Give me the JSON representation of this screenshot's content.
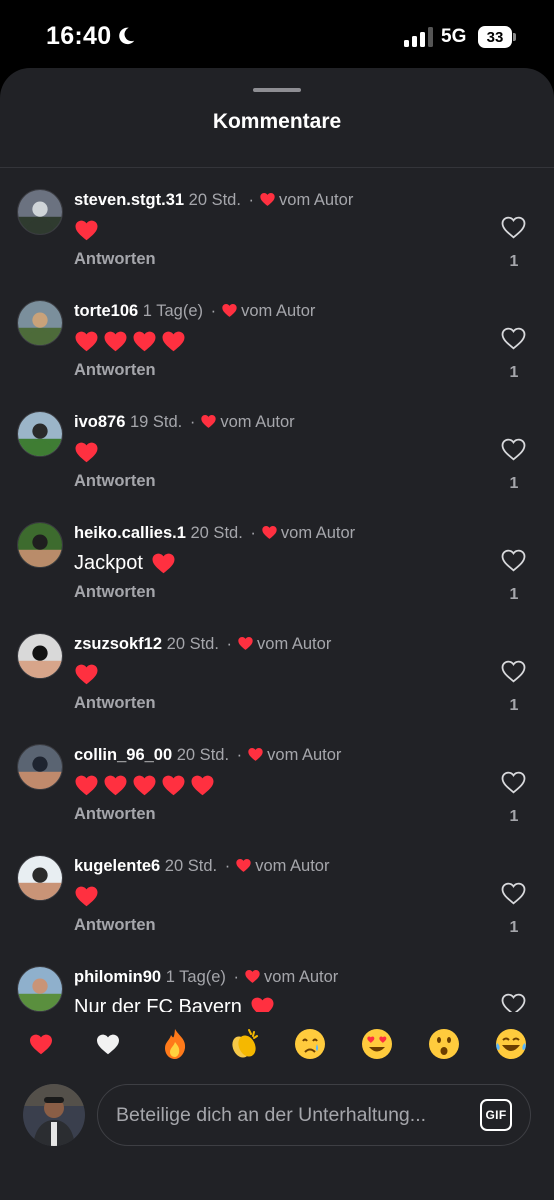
{
  "status_bar": {
    "time": "16:40",
    "network": "5G",
    "battery": "33"
  },
  "sheet": {
    "title": "Kommentare"
  },
  "comments": [
    {
      "username": "steven.stgt.31",
      "time": "20 Std.",
      "author_label": "vom Autor",
      "text": "",
      "hearts": 1,
      "reply_label": "Antworten",
      "likes": "1",
      "avatar_colors": [
        "#6b7280",
        "#2f3b2f",
        "#cfd4d8"
      ]
    },
    {
      "username": "torte106",
      "time": "1 Tag(e)",
      "author_label": "vom Autor",
      "text": "",
      "hearts": 4,
      "reply_label": "Antworten",
      "likes": "1",
      "avatar_colors": [
        "#7b8f9c",
        "#4d6b3a",
        "#c9a27a"
      ]
    },
    {
      "username": "ivo876",
      "time": "19 Std.",
      "author_label": "vom Autor",
      "text": "",
      "hearts": 1,
      "reply_label": "Antworten",
      "likes": "1",
      "avatar_colors": [
        "#9bb5c8",
        "#3f7d34",
        "#2a2a2a"
      ]
    },
    {
      "username": "heiko.callies.1",
      "time": "20 Std.",
      "author_label": "vom Autor",
      "text": "Jackpot",
      "hearts": 1,
      "reply_label": "Antworten",
      "likes": "1",
      "avatar_colors": [
        "#3d6b2e",
        "#b98c6a",
        "#1f1f1f"
      ]
    },
    {
      "username": "zsuzsokf12",
      "time": "20 Std.",
      "author_label": "vom Autor",
      "text": "",
      "hearts": 1,
      "reply_label": "Antworten",
      "likes": "1",
      "avatar_colors": [
        "#d9d9d9",
        "#d7a58a",
        "#111111"
      ]
    },
    {
      "username": "collin_96_00",
      "time": "20 Std.",
      "author_label": "vom Autor",
      "text": "",
      "hearts": 5,
      "reply_label": "Antworten",
      "likes": "1",
      "avatar_colors": [
        "#5a6472",
        "#c08a6c",
        "#1e2430"
      ]
    },
    {
      "username": "kugelente6",
      "time": "20 Std.",
      "author_label": "vom Autor",
      "text": "",
      "hearts": 1,
      "reply_label": "Antworten",
      "likes": "1",
      "avatar_colors": [
        "#e8eef2",
        "#c99477",
        "#2b2b2b"
      ]
    },
    {
      "username": "philomin90",
      "time": "1 Tag(e)",
      "author_label": "vom Autor",
      "text": "Nur der FC Bayern",
      "hearts": 1,
      "reply_label": "",
      "likes": "",
      "avatar_colors": [
        "#8fb0cc",
        "#5a8f3e",
        "#c99477"
      ]
    }
  ],
  "reactions": [
    {
      "name": "red-heart-emoji"
    },
    {
      "name": "white-heart-emoji"
    },
    {
      "name": "fire-emoji"
    },
    {
      "name": "clapping-hands-emoji"
    },
    {
      "name": "crying-face-emoji"
    },
    {
      "name": "heart-eyes-emoji"
    },
    {
      "name": "surprised-face-emoji"
    },
    {
      "name": "tears-of-joy-emoji"
    }
  ],
  "composer": {
    "placeholder": "Beteilige dich an der Unterhaltung...",
    "gif_label": "GIF"
  },
  "colors": {
    "sheet_bg": "#212226",
    "heart_red": "#ff3040",
    "muted_text": "#a5a6ab"
  }
}
